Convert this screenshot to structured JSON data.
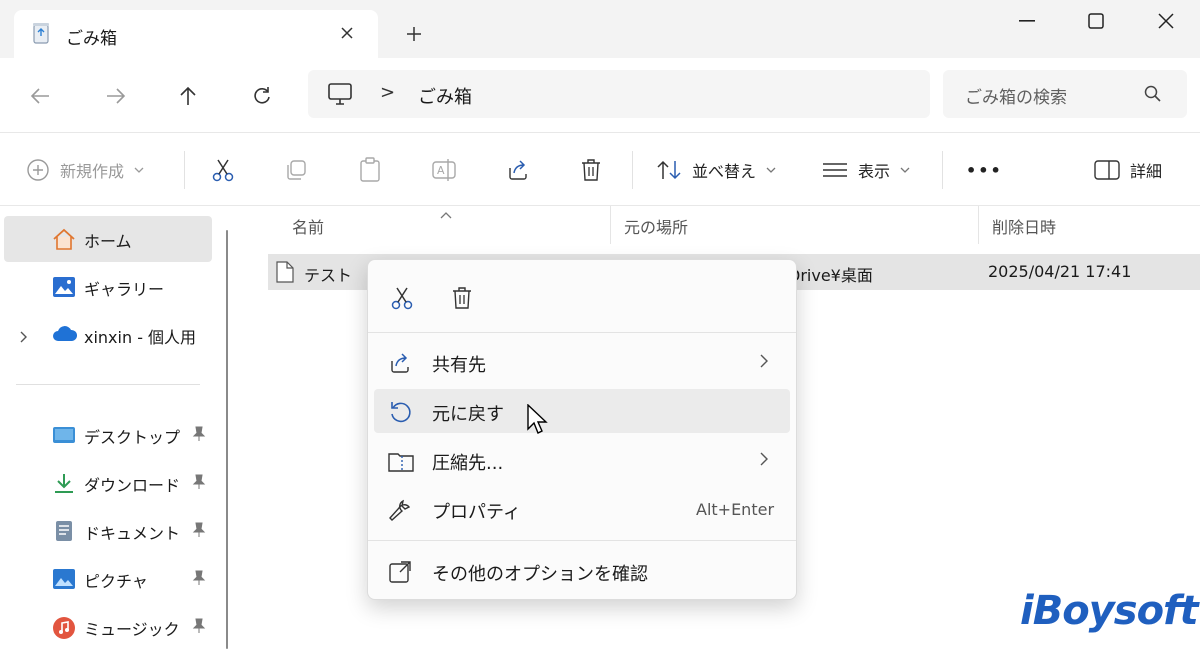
{
  "window": {
    "tab_title": "ごみ箱",
    "new_tab": "+",
    "minimize": "—",
    "maximize": "☐",
    "close": "✕"
  },
  "nav": {
    "address_separator": ">",
    "breadcrumb": "ごみ箱",
    "search_placeholder": "ごみ箱の検索"
  },
  "commands": {
    "new": "新規作成",
    "sort": "並べ替え",
    "view": "表示",
    "more": "•••",
    "details": "詳細"
  },
  "sidebar": {
    "items": [
      {
        "label": "ホーム",
        "icon": "home-icon",
        "active": true
      },
      {
        "label": "ギャラリー",
        "icon": "gallery-icon"
      },
      {
        "label": "xinxin - 個人用",
        "icon": "onedrive-icon"
      }
    ],
    "quick_access": [
      {
        "label": "デスクトップ",
        "icon": "desktop-icon"
      },
      {
        "label": "ダウンロード",
        "icon": "download-icon"
      },
      {
        "label": "ドキュメント",
        "icon": "document-icon"
      },
      {
        "label": "ピクチャ",
        "icon": "pictures-icon"
      },
      {
        "label": "ミュージック",
        "icon": "music-icon"
      }
    ]
  },
  "table": {
    "columns": [
      "名前",
      "元の場所",
      "削除日時"
    ],
    "rows": [
      {
        "name": "テスト",
        "location": "Drive¥桌面",
        "deleted": "2025/04/21 17:41"
      }
    ]
  },
  "context_menu": {
    "items": [
      {
        "label": "共有先",
        "icon": "share-icon",
        "submenu": true
      },
      {
        "label": "元に戻す",
        "icon": "restore-icon",
        "hover": true
      },
      {
        "label": "圧縮先...",
        "icon": "zip-icon",
        "submenu": true
      },
      {
        "label": "プロパティ",
        "icon": "wrench-icon",
        "shortcut": "Alt+Enter"
      },
      {
        "label": "その他のオプションを確認",
        "icon": "more-options-icon"
      }
    ]
  },
  "watermark": "iBoysoft",
  "colors": {
    "accent": "#1f5fbf",
    "hover": "#ebebeb",
    "selected_row": "#e4e4e4"
  }
}
